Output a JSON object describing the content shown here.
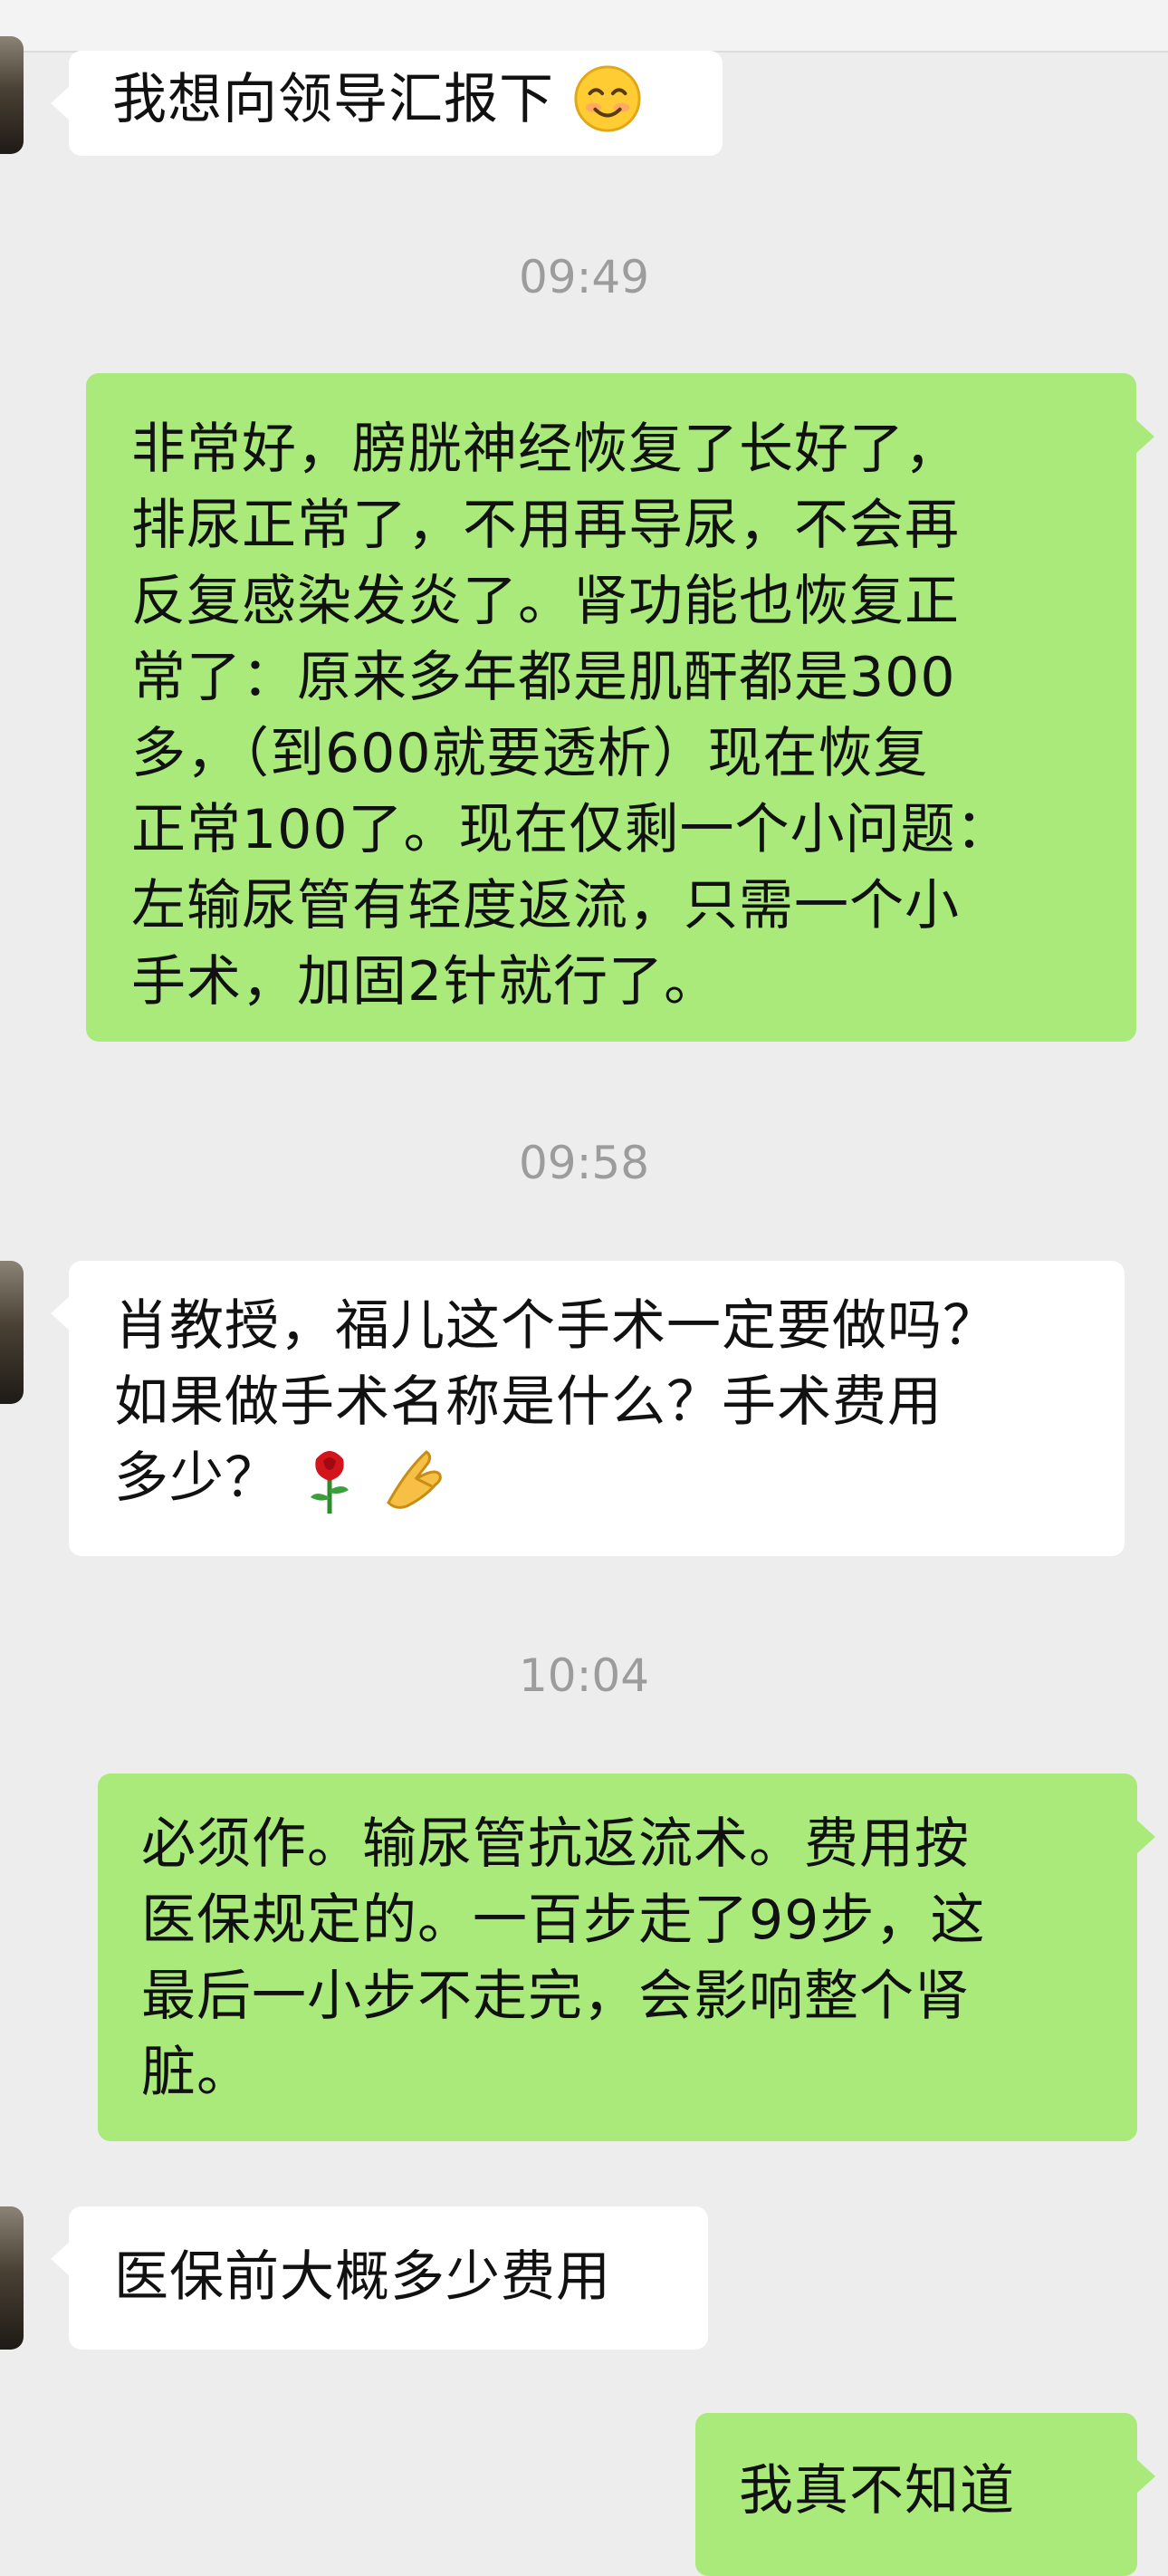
{
  "messages": [
    {
      "side": "in",
      "text": "我想向领导汇报下",
      "emoji": "smiling-face-icon"
    },
    {
      "time": "09:49"
    },
    {
      "side": "out",
      "text": "非常好，膀胱神经恢复了长好了，\n排尿正常了，不用再导尿，不会再\n反复感染发炎了。肾功能也恢复正\n常了：原来多年都是肌酐都是300\n多，（到600就要透析）现在恢复\n正常100了。现在仅剩一个小问题：\n左输尿管有轻度返流，只需一个小\n手术，加固2针就行了。"
    },
    {
      "time": "09:58"
    },
    {
      "side": "in",
      "text": "肖教授，福儿这个手术一定要做吗？\n如果做手术名称是什么？手术费用\n多少？",
      "emoji": [
        "rose-icon",
        "folded-hands-icon"
      ]
    },
    {
      "time": "10:04"
    },
    {
      "side": "out",
      "text": "必须作。输尿管抗返流术。费用按\n医保规定的。一百步走了99步，这\n最后一小步不走完，会影响整个肾\n脏。"
    },
    {
      "side": "in",
      "text": "医保前大概多少费用"
    },
    {
      "side": "out",
      "text": "我真不知道"
    }
  ],
  "colors": {
    "background": "#ededed",
    "outgoing": "#a9ea7a",
    "incoming": "#ffffff",
    "time": "#9c9c9c"
  }
}
